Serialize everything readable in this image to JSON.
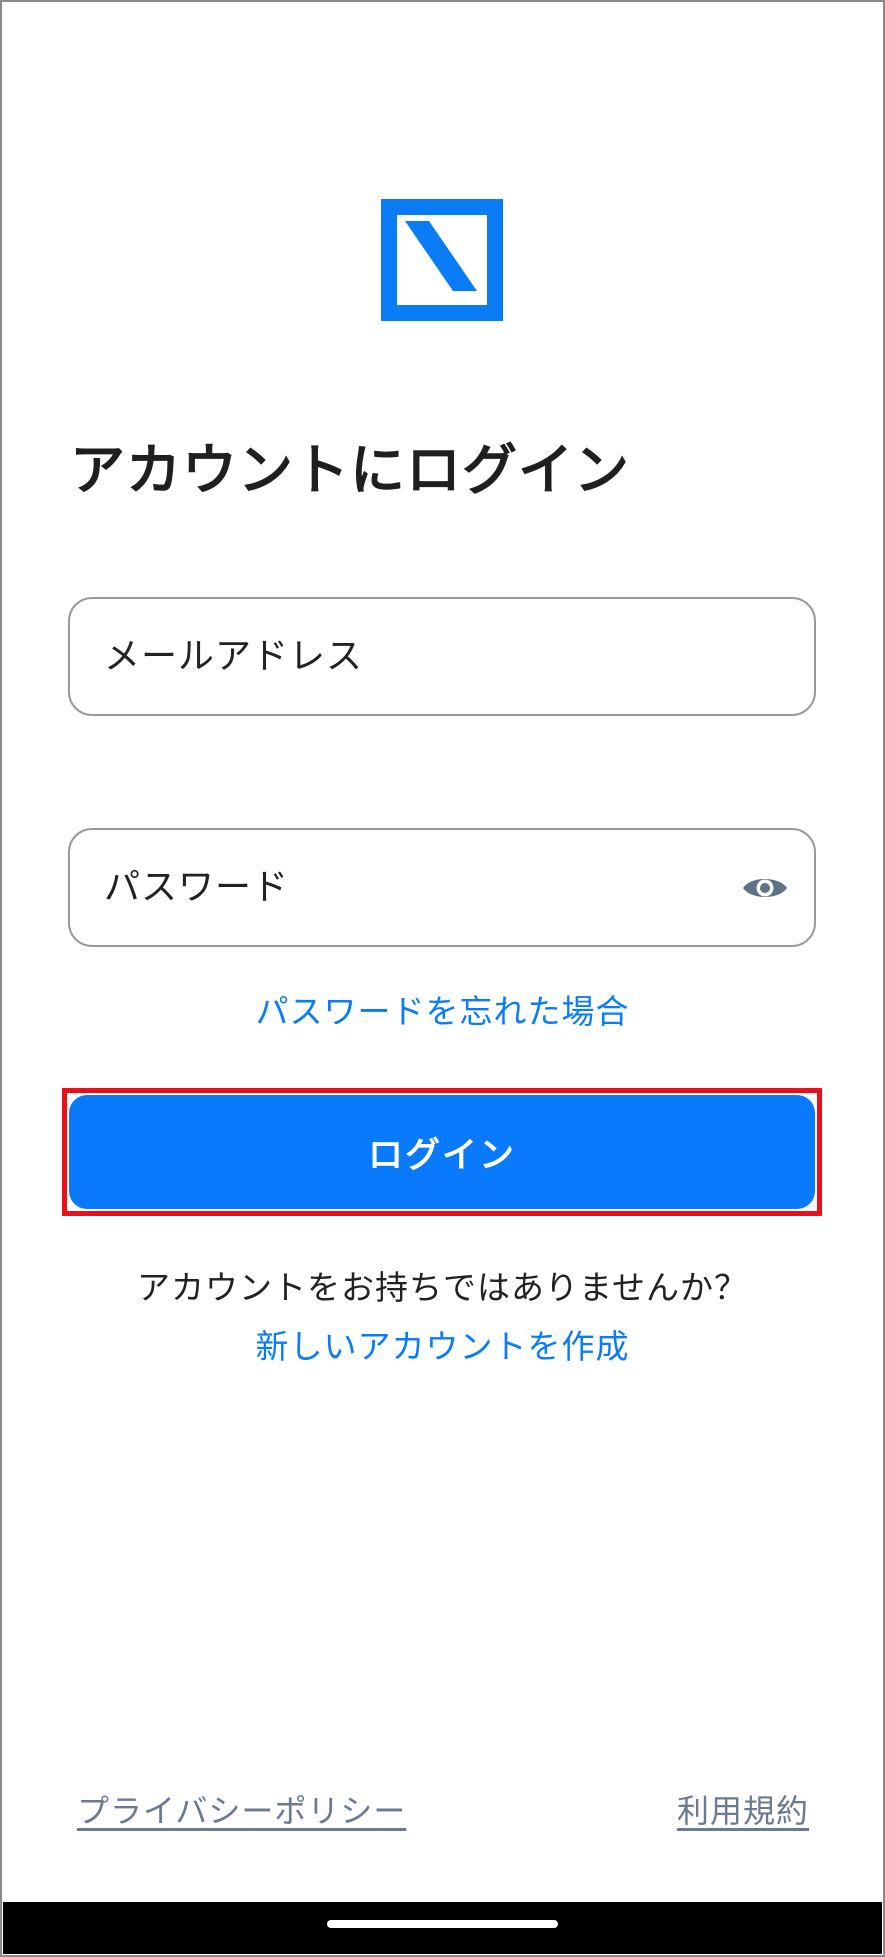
{
  "header": {
    "logo_icon": "app-logo-icon",
    "title": "アカウントにログイン"
  },
  "form": {
    "email_placeholder": "メールアドレス",
    "password_placeholder": "パスワード",
    "password_toggle_icon": "eye-icon",
    "forgot_password_label": "パスワードを忘れた場合",
    "login_button_label": "ログイン"
  },
  "signup": {
    "prompt": "アカウントをお持ちではありませんか？",
    "create_account_label": "新しいアカウントを作成"
  },
  "footer": {
    "privacy_label": "プライバシーポリシー",
    "terms_label": "利用規約"
  },
  "colors": {
    "accent": "#0a7afc",
    "link": "#0a7df6",
    "highlight_border": "#e8101a",
    "footer_link": "#6b7a90"
  }
}
